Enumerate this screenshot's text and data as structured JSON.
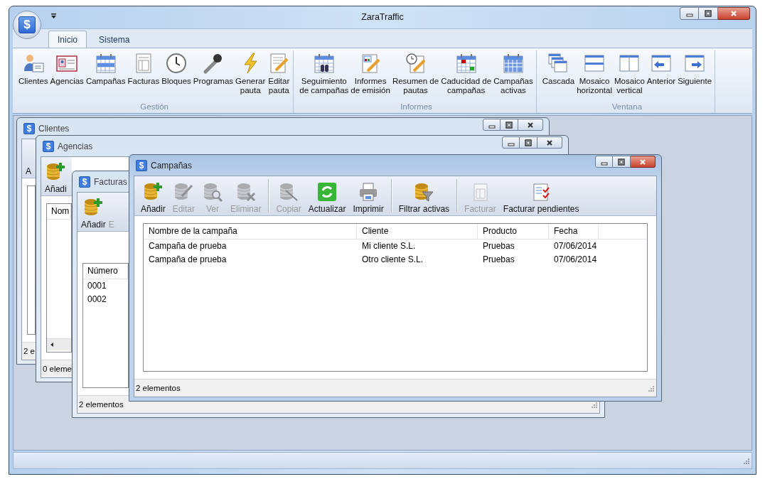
{
  "window": {
    "title": "ZaraTraffic",
    "app_icon": "$"
  },
  "ribbon": {
    "tabs": [
      {
        "label": "Inicio",
        "selected": true
      },
      {
        "label": "Sistema",
        "selected": false
      }
    ],
    "groups": [
      {
        "label": "Gestión",
        "buttons": [
          "Clientes",
          "Agencias",
          "Campañas",
          "Facturas",
          "Bloques",
          "Programas",
          "Generar\npauta",
          "Editar\npauta"
        ]
      },
      {
        "label": "Informes",
        "buttons": [
          "Seguimiento\nde campañas",
          "Informes\nde emisión",
          "Resumen de\npautas",
          "Caducidad de\ncampañas",
          "Campañas\nactivas"
        ]
      },
      {
        "label": "Ventana",
        "buttons": [
          "Cascada",
          "Mosaico\nhorizontal",
          "Mosaico\nvertical",
          "Anterior",
          "Siguiente"
        ]
      }
    ]
  },
  "child_windows": [
    {
      "icon": "$",
      "title": "Clientes",
      "active": false,
      "toolbar": [
        {
          "items": [
            {
              "label": "A",
              "disabled": false
            }
          ]
        }
      ],
      "status": "2 e"
    },
    {
      "icon": "$",
      "title": "Agencias",
      "active": false,
      "toolbar": [
        {
          "items": [
            {
              "label": "Añadi",
              "disabled": false
            }
          ]
        }
      ],
      "columns": [
        "Nom"
      ],
      "status": "0 eleme"
    },
    {
      "icon": "$",
      "title": "Facturas",
      "active": false,
      "toolbar": [
        {
          "items": [
            {
              "label": "Añadir",
              "disabled": false
            },
            {
              "label": "E",
              "disabled": true
            }
          ]
        }
      ],
      "columns": [
        "Número"
      ],
      "rows": [
        [
          "0001"
        ],
        [
          "0002"
        ]
      ],
      "status": "2 elementos"
    },
    {
      "icon": "$",
      "title": "Campañas",
      "active": true,
      "toolbar": [
        {
          "items": [
            {
              "label": "Añadir",
              "disabled": false
            },
            {
              "label": "Editar",
              "disabled": true
            },
            {
              "label": "Ver",
              "disabled": true
            },
            {
              "label": "Eliminar",
              "disabled": true
            }
          ]
        },
        {
          "items": [
            {
              "label": "Copiar",
              "disabled": true
            },
            {
              "label": "Actualizar",
              "disabled": false
            },
            {
              "label": "Imprimir",
              "disabled": false
            }
          ]
        },
        {
          "items": [
            {
              "label": "Filtrar activas",
              "disabled": false
            }
          ]
        },
        {
          "items": [
            {
              "label": "Facturar",
              "disabled": true
            },
            {
              "label": "Facturar pendientes",
              "disabled": false
            }
          ]
        }
      ],
      "columns": [
        "Nombre de la campaña",
        "Cliente",
        "Producto",
        "Fecha"
      ],
      "rows": [
        [
          "Campaña de prueba",
          "Mi cliente S.L.",
          "Pruebas",
          "07/06/2014"
        ],
        [
          "Campaña de prueba",
          "Otro cliente S.L.",
          "Pruebas",
          "07/06/2014"
        ]
      ],
      "status": "2 elementos"
    }
  ]
}
